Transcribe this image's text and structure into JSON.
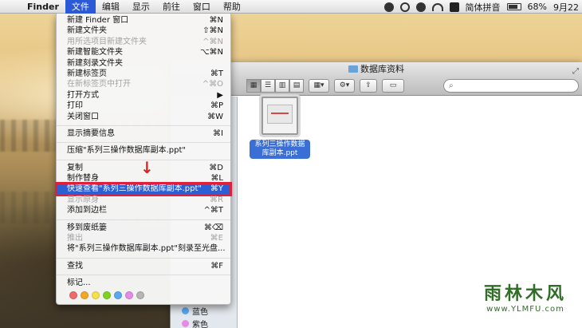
{
  "menubar": {
    "app_name": "Finder",
    "items": [
      "文件",
      "编辑",
      "显示",
      "前往",
      "窗口",
      "帮助"
    ],
    "input_method": "简体拼音",
    "battery": "68%",
    "date": "9月22"
  },
  "finder_window": {
    "title": "数据库资料",
    "search_placeholder": "",
    "file_name": "系列三操作数据库副本.ppt",
    "sidebar_tags": [
      "蓝色",
      "紫色"
    ]
  },
  "file_menu": {
    "items": [
      {
        "label": "新建 Finder 窗口",
        "shortcut": "⌘N",
        "disabled": false
      },
      {
        "label": "新建文件夹",
        "shortcut": "⇧⌘N",
        "disabled": false
      },
      {
        "label": "用所选项目新建文件夹",
        "shortcut": "^⌘N",
        "disabled": true
      },
      {
        "label": "新建智能文件夹",
        "shortcut": "⌥⌘N",
        "disabled": false
      },
      {
        "label": "新建刻录文件夹",
        "shortcut": "",
        "disabled": false
      },
      {
        "label": "新建标签页",
        "shortcut": "⌘T",
        "disabled": false
      },
      {
        "label": "在新标签页中打开",
        "shortcut": "^⌘O",
        "disabled": true
      },
      {
        "label": "打开方式",
        "shortcut": "▶",
        "disabled": false
      },
      {
        "label": "打印",
        "shortcut": "⌘P",
        "disabled": false
      },
      {
        "label": "关闭窗口",
        "shortcut": "⌘W",
        "disabled": false
      },
      {
        "label": "显示摘要信息",
        "shortcut": "⌘I",
        "disabled": false
      },
      {
        "label": "压缩\"系列三操作数据库副本.ppt\"",
        "shortcut": "",
        "disabled": false
      },
      {
        "label": "复制",
        "shortcut": "⌘D",
        "disabled": false
      },
      {
        "label": "制作替身",
        "shortcut": "⌘L",
        "disabled": false
      },
      {
        "label": "快速查看\"系列三操作数据库副本.ppt\"",
        "shortcut": "⌘Y",
        "disabled": false,
        "highlighted": true
      },
      {
        "label": "显示原身",
        "shortcut": "⌘R",
        "disabled": true
      },
      {
        "label": "添加到边栏",
        "shortcut": "^⌘T",
        "disabled": false
      },
      {
        "label": "移到废纸篓",
        "shortcut": "⌘⌫",
        "disabled": false
      },
      {
        "label": "推出",
        "shortcut": "⌘E",
        "disabled": true
      },
      {
        "label": "将\"系列三操作数据库副本.ppt\"刻录至光盘...",
        "shortcut": "",
        "disabled": false
      },
      {
        "label": "查找",
        "shortcut": "⌘F",
        "disabled": false
      },
      {
        "label": "标记...",
        "shortcut": "",
        "disabled": false
      }
    ],
    "tag_colors": [
      "#f06a6a",
      "#f5a623",
      "#f8e04a",
      "#7ed321",
      "#5aa9f0",
      "#e58ae5",
      "#b5b5b5"
    ]
  },
  "watermark": {
    "title": "雨林木风",
    "url": "www.YLMFU.com"
  }
}
